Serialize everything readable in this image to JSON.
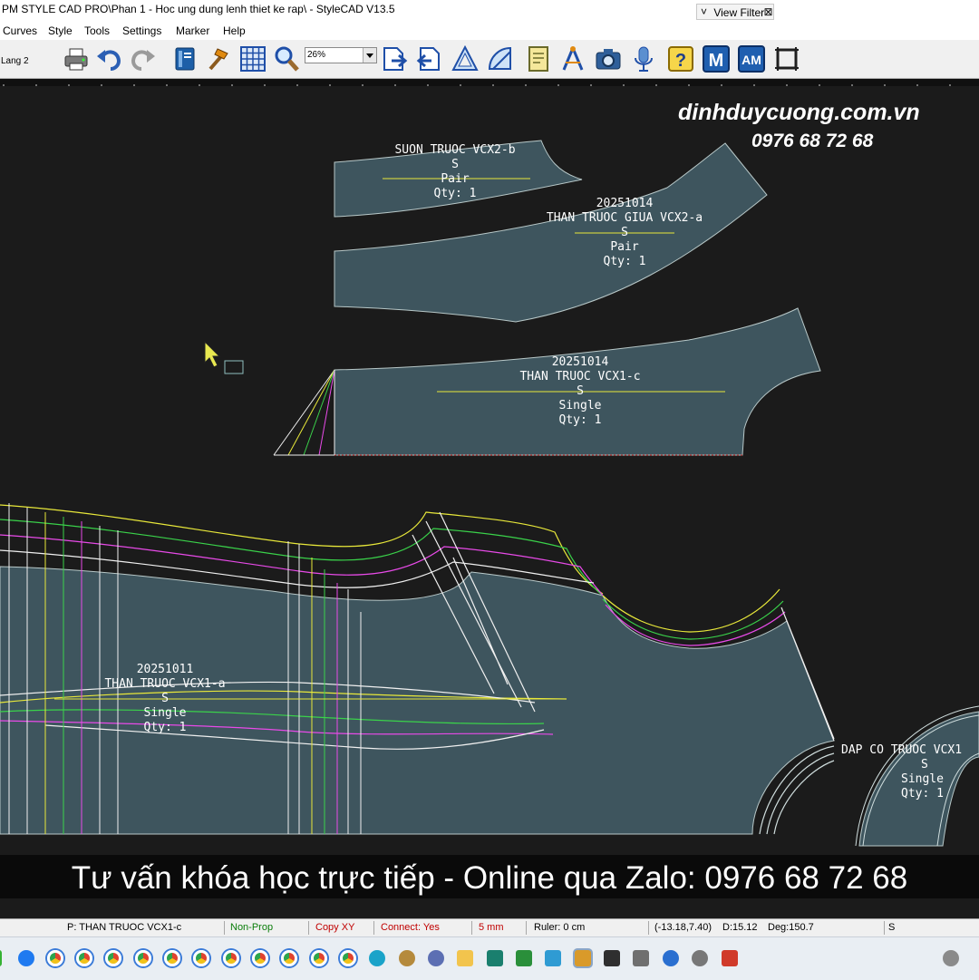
{
  "window": {
    "title": "PM STYLE CAD PRO\\Phan 1 - Hoc ung dung lenh thiet ke rap\\ - StyleCAD V13.5",
    "view_filter": "View Filter"
  },
  "menu": [
    "Curves",
    "Style",
    "Tools",
    "Settings",
    "Marker",
    "Help"
  ],
  "toolbar": {
    "layer": "Lang 2",
    "zoom": "26%",
    "icons": [
      "printer-icon",
      "undo-icon",
      "redo-icon",
      "book-icon",
      "hammer-icon",
      "grid-icon",
      "zoom-magnifier-icon",
      "page-export-icon",
      "page-import-icon",
      "set-square-icon",
      "protractor-icon",
      "note-icon",
      "compass-icon",
      "camera-icon",
      "microphone-icon",
      "help-icon",
      "m-icon",
      "am-icon",
      "frame-icon"
    ],
    "m_label": "M",
    "am_label": "AM",
    "help_label": "?"
  },
  "watermark": {
    "site": "dinhduycuong.com.vn",
    "phone": "0976 68 72 68"
  },
  "pieces": [
    {
      "date": "",
      "name": "SUON TRUOC VCX2-b",
      "size": "S",
      "mode": "Pair",
      "qty": "Qty: 1"
    },
    {
      "date": "20251014",
      "name": "THAN TRUOC GIUA VCX2-a",
      "size": "S",
      "mode": "Pair",
      "qty": "Qty: 1"
    },
    {
      "date": "20251014",
      "name": "THAN TRUOC VCX1-c",
      "size": "S",
      "mode": "Single",
      "qty": "Qty: 1"
    },
    {
      "date": "20251011",
      "name": "THAN TRUOC VCX1-a",
      "size": "S",
      "mode": "Single",
      "qty": "Qty: 1"
    },
    {
      "date": "",
      "name": "DAP CO TRUOC VCX1",
      "size": "S",
      "mode": "Single",
      "qty": "Qty: 1"
    }
  ],
  "banner": "Tư vấn khóa học trực tiếp - Online qua Zalo: 0976 68 72 68",
  "status": {
    "piece": "P: THAN TRUOC VCX1-c",
    "mode": "Non-Prop",
    "copy": "Copy XY",
    "connect": "Connect: Yes",
    "step": "5 mm",
    "ruler": "Ruler: 0 cm",
    "coords": "(-13.18,7.40)",
    "distance": "D:15.12",
    "degree": "Deg:150.7",
    "size": "S"
  },
  "colors": {
    "piece_fill": "#3e555e",
    "piece_outline": "#b8c8c8",
    "background": "#1b1b1b",
    "grade_yellow": "#e8e83a",
    "grade_green": "#3ad24a",
    "grade_magenta": "#e84ae8",
    "grade_white": "#f0f0f0",
    "status_green": "#0a7d0a",
    "status_red": "#c00000"
  },
  "taskbar": {
    "apps": [
      "windows-start-icon",
      "zalo-icon",
      "chrome-icon",
      "chrome-icon",
      "chrome-icon",
      "chrome-icon",
      "chrome-icon",
      "chrome-icon",
      "chrome-icon",
      "chrome-icon",
      "chrome-icon",
      "chrome-icon",
      "chrome-icon",
      "edge-icon",
      "app-icon",
      "app-icon",
      "file-explorer-icon",
      "app-icon",
      "app-icon",
      "app-icon",
      "stylecad-icon",
      "app-icon",
      "app-icon",
      "app-icon",
      "settings-icon",
      "app-icon"
    ]
  }
}
